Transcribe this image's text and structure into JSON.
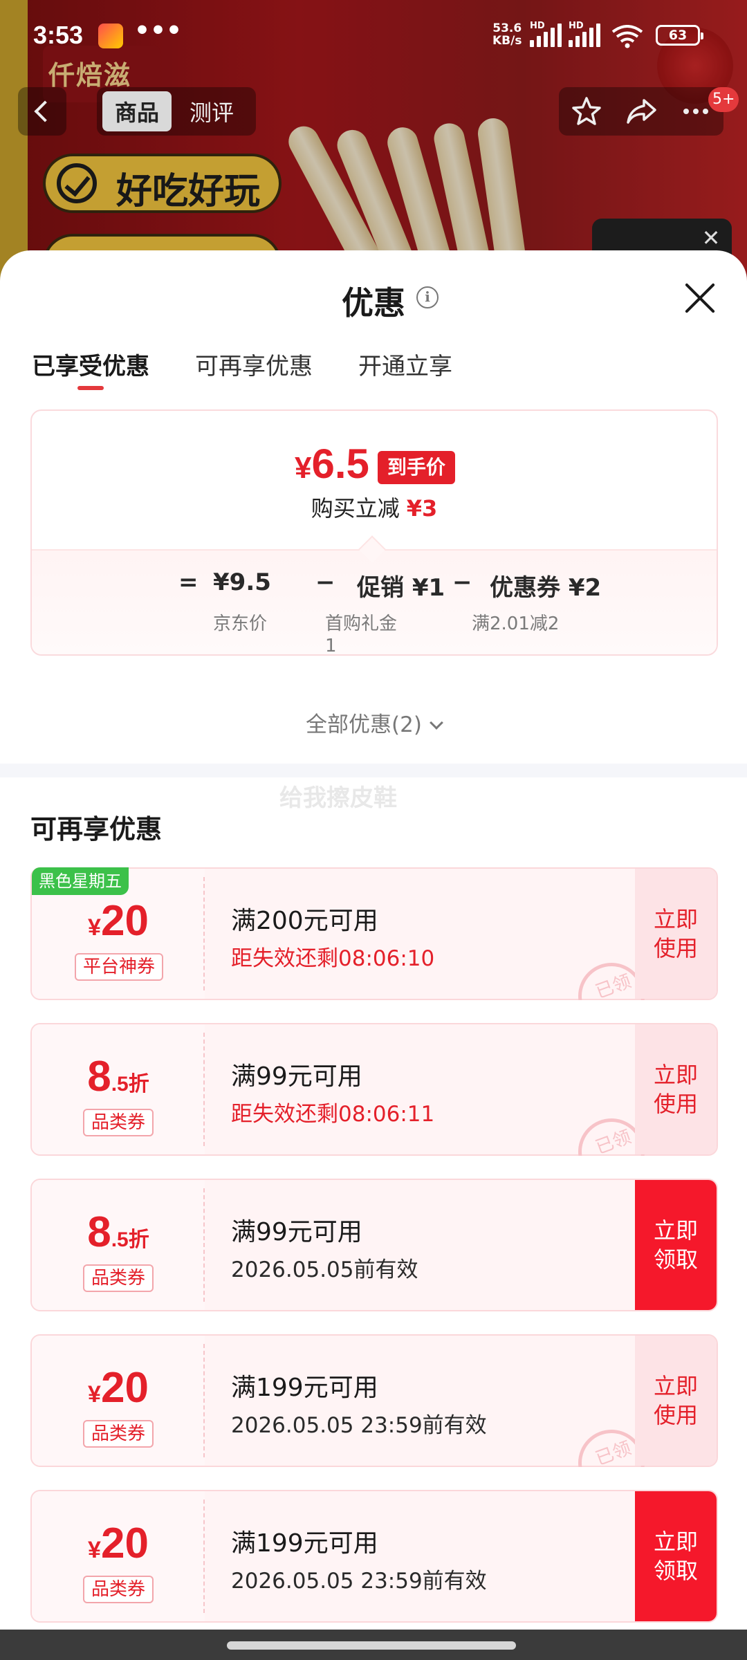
{
  "status_bar": {
    "time": "3:53",
    "more": "•••",
    "net_speed_value": "53.6",
    "net_speed_unit": "KB/s",
    "hd1": "HD",
    "hd2": "HD",
    "battery": "63"
  },
  "background": {
    "brand": "仟焙滋",
    "slogan": "好吃好玩"
  },
  "nav": {
    "tabs": [
      "商品",
      "测评"
    ],
    "active_tab": "商品",
    "badge": "5+",
    "thumb_close": "✕"
  },
  "sheet": {
    "title": "优惠",
    "info_icon": "i",
    "tabs": [
      "已享受优惠",
      "可再享优惠",
      "开通立享"
    ],
    "active_tab": "已享受优惠"
  },
  "summary": {
    "final_symbol": "¥",
    "final_value": "6.5",
    "final_tag": "到手价",
    "reduce_label": "购买立减",
    "reduce_value": "¥3",
    "formula": {
      "equals": "=",
      "jd_price": "¥9.5",
      "minus1": "−",
      "promo": "促销 ¥1",
      "minus2": "−",
      "coupon": "优惠券 ¥2",
      "jd_price_label": "京东价",
      "promo_label_line1": "首购礼金",
      "promo_label_line2": "1",
      "coupon_label": "满2.01减2"
    }
  },
  "all_offers": "全部优惠(2)",
  "watermark": "给我擦皮鞋",
  "section_title": "可再享优惠",
  "coupons": [
    {
      "corner_tag": "黑色星期五",
      "value_symbol": "¥",
      "value": "20",
      "type": "平台神券",
      "condition": "满200元可用",
      "sub": "距失效还剩08:06:10",
      "action_line1": "立即",
      "action_line2": "使用",
      "stamp": "已领"
    },
    {
      "value": "8",
      "value_suffix": ".5折",
      "type": "品类券",
      "condition": "满99元可用",
      "sub": "距失效还剩08:06:11",
      "action_line1": "立即",
      "action_line2": "使用",
      "stamp": "已领"
    },
    {
      "value": "8",
      "value_suffix": ".5折",
      "type": "品类券",
      "condition": "满99元可用",
      "sub": "2026.05.05前有效",
      "action_line1": "立即",
      "action_line2": "领取"
    },
    {
      "value_symbol": "¥",
      "value": "20",
      "type": "品类券",
      "condition": "满199元可用",
      "sub": "2026.05.05 23:59前有效",
      "action_line1": "立即",
      "action_line2": "使用",
      "stamp": "已领"
    },
    {
      "value_symbol": "¥",
      "value": "20",
      "type": "品类券",
      "condition": "满199元可用",
      "sub": "2026.05.05 23:59前有效",
      "action_line1": "立即",
      "action_line2": "领取"
    }
  ],
  "colors": {
    "accent_red": "#e4202a",
    "primary_button": "#f5182b",
    "corner_tag_green": "#3cc14a"
  }
}
